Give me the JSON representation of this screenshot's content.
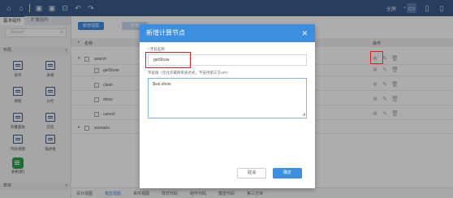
{
  "toolbar": {
    "icons": [
      "home-icon",
      "home-alt-icon",
      "save-icon",
      "save-as-icon",
      "preview-icon",
      "undo-icon",
      "redo-icon"
    ],
    "fullscreen_label": "全屏",
    "devices": [
      "desktop-icon",
      "tablet-icon",
      "mobile-icon"
    ]
  },
  "left_panel": {
    "tabs": [
      "基本组件",
      "扩展组件"
    ],
    "search_placeholder": "Search",
    "section_layout": "布局",
    "components": [
      {
        "label": "表单",
        "icon": "form-icon"
      },
      {
        "label": "表格",
        "icon": "table-icon"
      },
      {
        "label": "弹窗",
        "icon": "dialog-icon"
      },
      {
        "label": "分栏",
        "icon": "columns-icon"
      },
      {
        "label": "折叠面板",
        "icon": "collapse-icon"
      },
      {
        "label": "页签",
        "icon": "tabs-icon"
      },
      {
        "label": "列表视图",
        "icon": "list-view-icon"
      },
      {
        "label": "描述框",
        "icon": "description-icon"
      },
      {
        "label": "表格(新)",
        "icon": "table-new-icon"
      }
    ],
    "section_form": "表单"
  },
  "main": {
    "add_button": "新增视图",
    "second_button": "新增",
    "table_header": {
      "name": "名称",
      "ops": "操作"
    },
    "rows": [
      {
        "name": "search",
        "level": 0,
        "expand": "▾"
      },
      {
        "name": "getShow",
        "level": 1,
        "expand": ""
      },
      {
        "name": "clean",
        "level": 1,
        "expand": ""
      },
      {
        "name": "show",
        "level": 1,
        "expand": ""
      },
      {
        "name": "cancel",
        "level": 1,
        "expand": ""
      },
      {
        "name": "scenario",
        "level": 0,
        "expand": "▸"
      }
    ],
    "bottom_tabs": [
      "设计视图",
      "模型视图",
      "事件视图",
      "样式代码",
      "组件代码",
      "模型代码",
      "第三方库"
    ],
    "active_bottom_tab": "模型视图"
  },
  "modal": {
    "title": "新增计算节点",
    "field_name_label": "* 字段名称",
    "field_name_value": "getShow",
    "value_label": "字段值（仅允许最简单表达式，不支持第三方API）",
    "value_text": "$var.show",
    "cancel_label": "取消",
    "ok_label": "确定"
  },
  "colors": {
    "topbar": "#3c5c8c",
    "primary": "#3c8ee0",
    "highlight": "#e02020"
  }
}
